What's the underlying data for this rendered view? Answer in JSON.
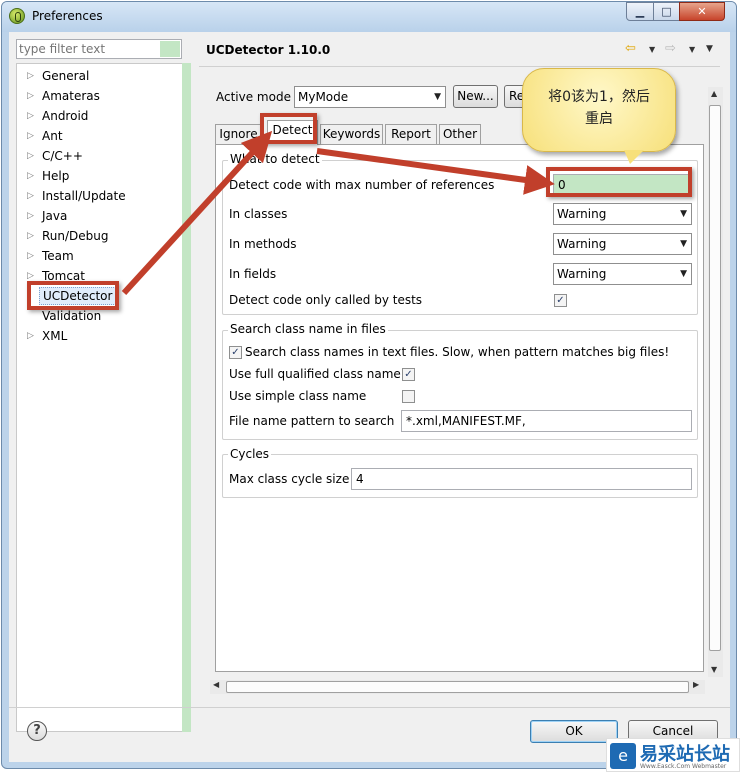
{
  "window": {
    "title": "Preferences",
    "min": "▁",
    "max": "□",
    "close": "✕"
  },
  "filter": {
    "placeholder": "type filter text"
  },
  "tree": [
    {
      "label": "General",
      "arrow": "▷"
    },
    {
      "label": "Amateras",
      "arrow": "▷"
    },
    {
      "label": "Android",
      "arrow": "▷"
    },
    {
      "label": "Ant",
      "arrow": "▷"
    },
    {
      "label": "C/C++",
      "arrow": "▷"
    },
    {
      "label": "Help",
      "arrow": "▷"
    },
    {
      "label": "Install/Update",
      "arrow": "▷"
    },
    {
      "label": "Java",
      "arrow": "▷"
    },
    {
      "label": "Run/Debug",
      "arrow": "▷"
    },
    {
      "label": "Team",
      "arrow": "▷"
    },
    {
      "label": "Tomcat",
      "arrow": "▷"
    },
    {
      "label": "UCDetector",
      "arrow": "",
      "selected": true
    },
    {
      "label": "Validation",
      "arrow": ""
    },
    {
      "label": "XML",
      "arrow": "▷"
    }
  ],
  "page": {
    "title": "UCDetector 1.10.0",
    "nav": {
      "back": "⇦",
      "forward": "⇨",
      "dropdown": "▼",
      "menu": "▼"
    }
  },
  "mode": {
    "label": "Active mode",
    "value": "MyMode",
    "new_button": "New...",
    "remove_button": "Re"
  },
  "tabs": [
    "Ignore",
    "Detect",
    "Keywords",
    "Report",
    "Other"
  ],
  "active_tab": "Detect",
  "what_to_detect": {
    "title": "What to detect",
    "max_refs_label": "Detect code with max number of references",
    "max_refs_value": "0",
    "in_classes_label": "In classes",
    "in_classes_value": "Warning",
    "in_methods_label": "In methods",
    "in_methods_value": "Warning",
    "in_fields_label": "In fields",
    "in_fields_value": "Warning",
    "tests_only_label": "Detect code only called by tests",
    "tests_only_checked": "✓"
  },
  "search_class": {
    "title": "Search class name in files",
    "search_text_label": "Search class names in text files. Slow, when pattern matches big files!",
    "search_text_checked": "✓",
    "full_qualified_label": "Use full qualified class name",
    "full_qualified_checked": "✓",
    "simple_name_label": "Use simple class name",
    "simple_name_checked": "",
    "pattern_label": "File name pattern to search",
    "pattern_value": "*.xml,MANIFEST.MF,"
  },
  "cycles": {
    "title": "Cycles",
    "max_size_label": "Max class cycle size",
    "max_size_value": "4"
  },
  "buttons": {
    "ok": "OK",
    "cancel": "Cancel",
    "help": "?"
  },
  "annotation": {
    "callout_line1": "将0该为1，然后",
    "callout_line2": "重启",
    "color": "#c13f2b"
  },
  "watermark": {
    "text": "易采站长站",
    "sub": "Www.Easck.Com  Webmaster"
  },
  "dropdown_glyph": "▼"
}
